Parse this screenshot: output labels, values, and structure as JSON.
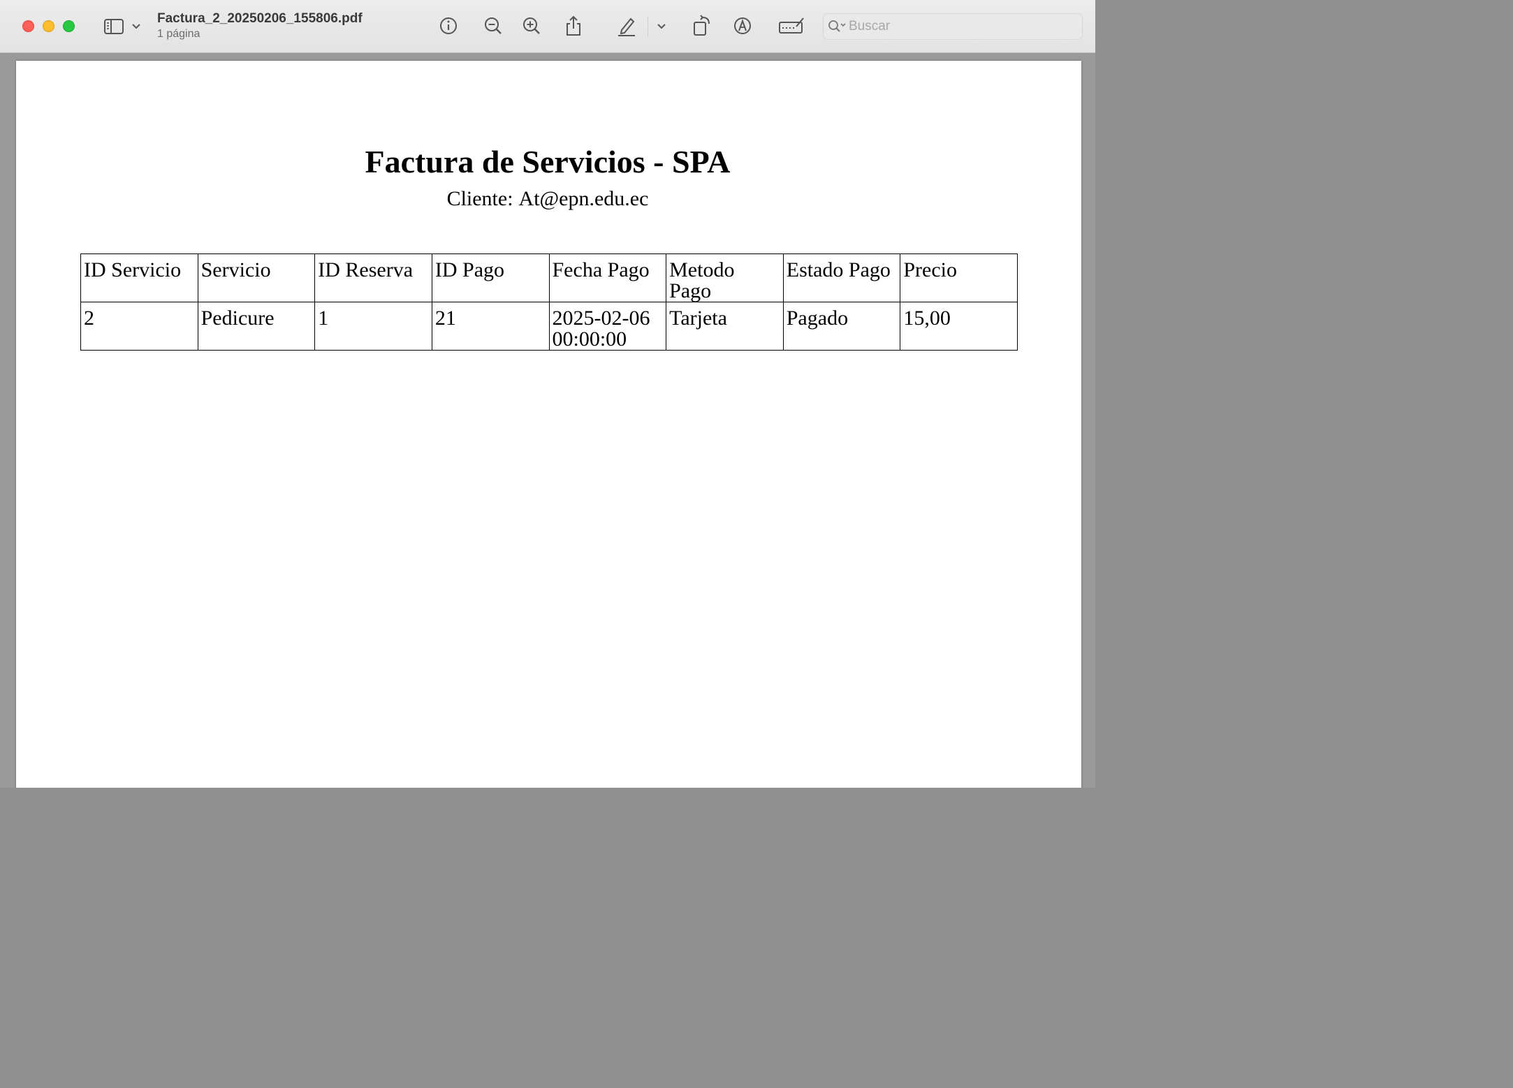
{
  "window": {
    "controls": {
      "close": "close",
      "minimize": "minimize",
      "zoom": "zoom"
    },
    "document_title": "Factura_2_20250206_155806.pdf",
    "document_subtitle": "1 página"
  },
  "toolbar": {
    "icons": [
      "sidebar-icon",
      "chevron-down-icon",
      "info-icon",
      "zoom-out-icon",
      "zoom-in-icon",
      "share-icon",
      "highlight-pen-icon",
      "chevron-down-icon",
      "rotate-icon",
      "markup-icon",
      "signature-icon",
      "search-icon"
    ],
    "search": {
      "placeholder": "Buscar",
      "value": ""
    }
  },
  "document": {
    "title": "Factura de Servicios - SPA",
    "client_label": "Cliente:",
    "client_email": "At@epn.edu.ec",
    "table": {
      "headers": [
        "ID Servicio",
        "Servicio",
        "ID Reserva",
        "ID Pago",
        "Fecha Pago",
        "Metodo Pago",
        "Estado Pago",
        "Precio"
      ],
      "rows": [
        [
          "2",
          "Pedicure",
          "1",
          "21",
          "2025-02-06 00:00:00",
          "Tarjeta",
          "Pagado",
          "15,00"
        ]
      ]
    }
  },
  "colors": {
    "toolbar_bg": "#e6e6e6",
    "window_bg": "#9a9a9a",
    "page_bg": "#ffffff",
    "close": "#fe5f57",
    "minimize": "#febc2e",
    "zoom": "#28c840",
    "icon": "#555555",
    "placeholder": "#a8a8a8"
  }
}
